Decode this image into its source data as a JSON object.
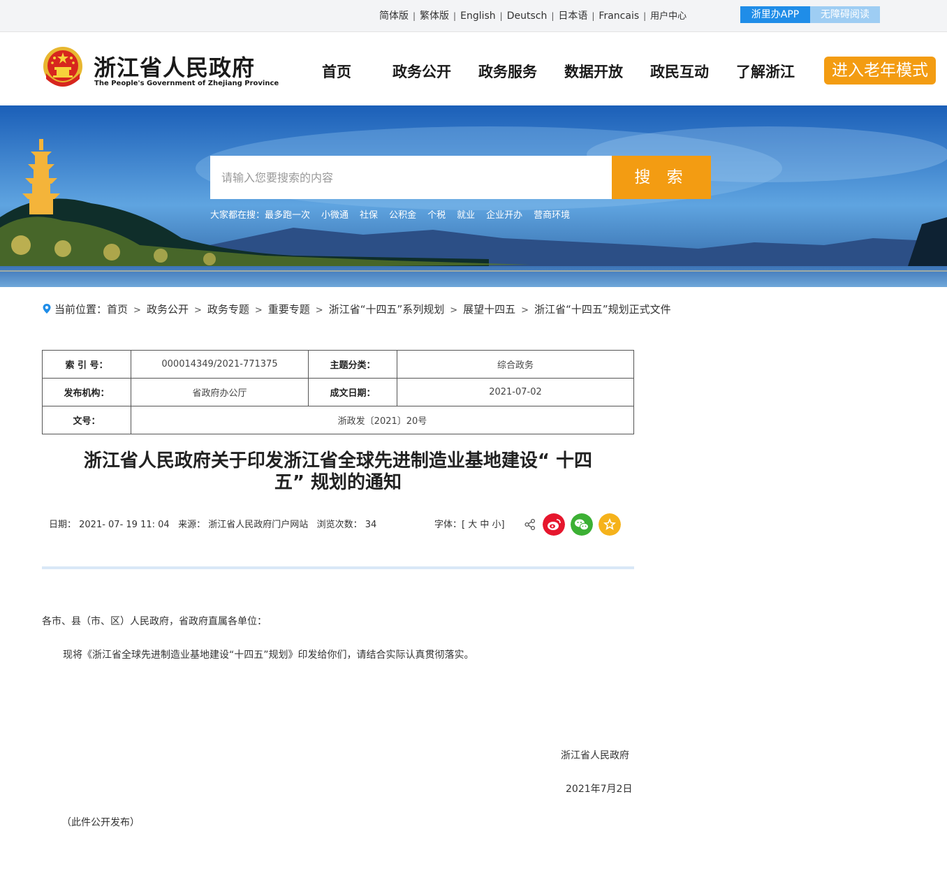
{
  "topbar": {
    "links": [
      "简体版",
      "繁体版",
      "English",
      "Deutsch",
      "日本语",
      "Francais",
      "用户中心"
    ],
    "app_button": "浙里办APP",
    "accessibility_button": "无障碍阅读"
  },
  "header": {
    "title": "浙江省人民政府",
    "subtitle": "The People's Government of Zhejiang Province",
    "nav": [
      "首页",
      "政务公开",
      "政务服务",
      "数据开放",
      "政民互动",
      "了解浙江"
    ],
    "elder_mode": "进入老年模式"
  },
  "search": {
    "placeholder": "请输入您要搜索的内容",
    "button": "搜 索",
    "hot_label": "大家都在搜：",
    "hot_items": [
      "最多跑一次",
      "小微通",
      "社保",
      "公积金",
      "个税",
      "就业",
      "企业开办",
      "营商环境"
    ]
  },
  "breadcrumb": {
    "label": "当前位置：",
    "items": [
      "首页",
      "政务公开",
      "政务专题",
      "重要专题",
      "浙江省“十四五”系列规划",
      "展望十四五",
      "浙江省“十四五”规划正式文件"
    ]
  },
  "meta": {
    "index_label": "索 引 号：",
    "index_value": "000014349/2021-771375",
    "topic_label": "主题分类：",
    "topic_value": "综合政务",
    "publisher_label": "发布机构：",
    "publisher_value": "省政府办公厅",
    "date_label": "成文日期：",
    "date_value": "2021-07-02",
    "doc_no_label": "文号：",
    "doc_no_value": "浙政发〔2021〕20号"
  },
  "article": {
    "title_line1": "浙江省人民政府关于印发浙江省全球先进制造业基地建设“ 十四",
    "title_line2": "五” 规划的通知",
    "date": "日期： 2021- 07- 19 11: 04",
    "source": "来源： 浙江省人民政府门户网站",
    "views": "浏览次数： 34",
    "font_size_label": "字体：[ 大 中 小]",
    "salutation": "各市、县（市、区）人民政府，省政府直属各单位：",
    "body": "现将《浙江省全球先进制造业基地建设“十四五”规划》印发给你们，请结合实际认真贯彻落实。",
    "signature": "浙江省人民政府",
    "sign_date": "2021年7月2日",
    "note": "（此件公开发布）"
  },
  "colors": {
    "accent_orange": "#f39c12",
    "app_blue": "#1f8de8",
    "weibo_red": "#e6162d",
    "wechat_green": "#3cb034",
    "favorite_yellow": "#f5b21b"
  }
}
